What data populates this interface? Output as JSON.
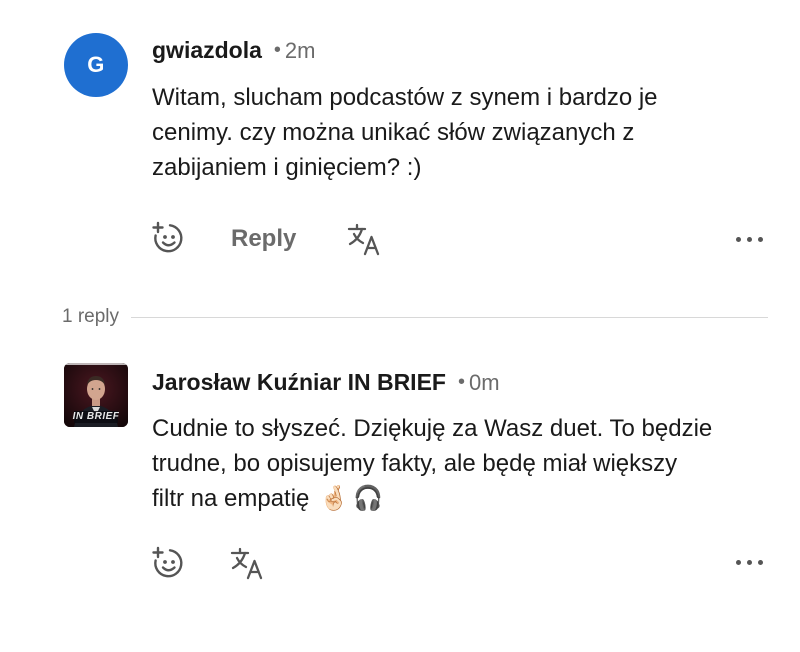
{
  "comment": {
    "avatar_letter": "G",
    "avatar_color": "#1f6fd1",
    "author": "gwiazdola",
    "separator": "•",
    "time": "2m",
    "text_lines": [
      "Witam, slucham podcastów z synem i bardzo je",
      "cenimy. czy można unikać słów związanych z",
      "zabijaniem i ginięciem? :)"
    ],
    "actions": {
      "react_icon": "add-reaction-icon",
      "reply_label": "Reply",
      "translate_icon": "translate-icon",
      "more_icon": "more-horizontal-icon"
    }
  },
  "replies": {
    "count_label": "1 reply"
  },
  "reply": {
    "avatar_caption": "IN BRIEF",
    "author": "Jarosław Kuźniar IN BRIEF",
    "separator": "•",
    "time": "0m",
    "text_lines": [
      "Cudnie to słyszeć. Dziękuję za Wasz duet. To będzie",
      "trudne, bo opisujemy fakty, ale będę miał większy",
      "filtr na empatię"
    ],
    "emoji": [
      "🤞🏻",
      "🎧"
    ],
    "actions": {
      "react_icon": "add-reaction-icon",
      "translate_icon": "translate-icon",
      "more_icon": "more-horizontal-icon"
    }
  }
}
